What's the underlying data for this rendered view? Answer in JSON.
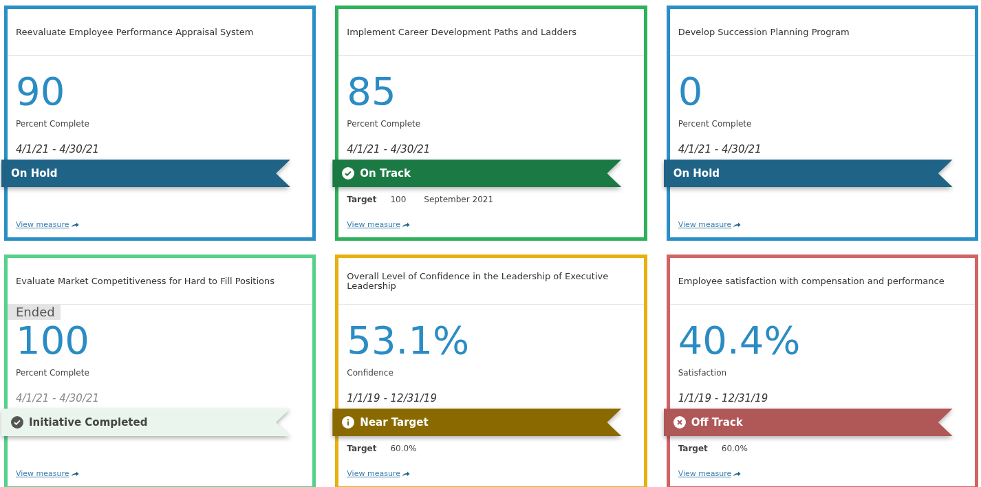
{
  "cards": [
    {
      "title": "Reevaluate Employee Performance Appraisal System",
      "color": "#2b8fc6",
      "value": "90",
      "value_label": "Percent Complete",
      "dates": "4/1/21 - 4/30/21",
      "status": {
        "kind": "on_hold",
        "label": "On Hold"
      },
      "link": "View measure"
    },
    {
      "title": "Implement Career Development Paths and Ladders",
      "color": "#2fb05a",
      "value": "85",
      "value_label": "Percent Complete",
      "dates": "4/1/21 - 4/30/21",
      "status": {
        "kind": "on_track",
        "label": "On Track"
      },
      "target": {
        "label": "Target",
        "value": "100",
        "date": "September 2021"
      },
      "link": "View measure"
    },
    {
      "title": "Develop Succession Planning Program",
      "color": "#2b8fc6",
      "value": "0",
      "value_label": "Percent Complete",
      "dates": "4/1/21 - 4/30/21",
      "status": {
        "kind": "on_hold",
        "label": "On Hold"
      },
      "link": "View measure"
    },
    {
      "title": "Evaluate Market Competitiveness for Hard to Fill Positions",
      "color": "#55d18a",
      "badge": "Ended",
      "value": "100",
      "value_label": "Percent Complete",
      "dates": "4/1/21 - 4/30/21",
      "status": {
        "kind": "completed",
        "label": "Initiative Completed"
      },
      "link": "View measure"
    },
    {
      "title": "Overall Level of Confidence in the Leadership of Executive Leadership",
      "color": "#e8b00f",
      "value": "53.1%",
      "value_label": "Confidence",
      "dates": "1/1/19 - 12/31/19",
      "status": {
        "kind": "near_target",
        "label": "Near Target"
      },
      "target": {
        "label": "Target",
        "value": "60.0%"
      },
      "link": "View measure"
    },
    {
      "title": "Employee satisfaction with compensation and performance",
      "color": "#d06464",
      "value": "40.4%",
      "value_label": "Satisfaction",
      "dates": "1/1/19 - 12/31/19",
      "status": {
        "kind": "off_track",
        "label": "Off Track"
      },
      "target": {
        "label": "Target",
        "value": "60.0%"
      },
      "link": "View measure"
    }
  ]
}
